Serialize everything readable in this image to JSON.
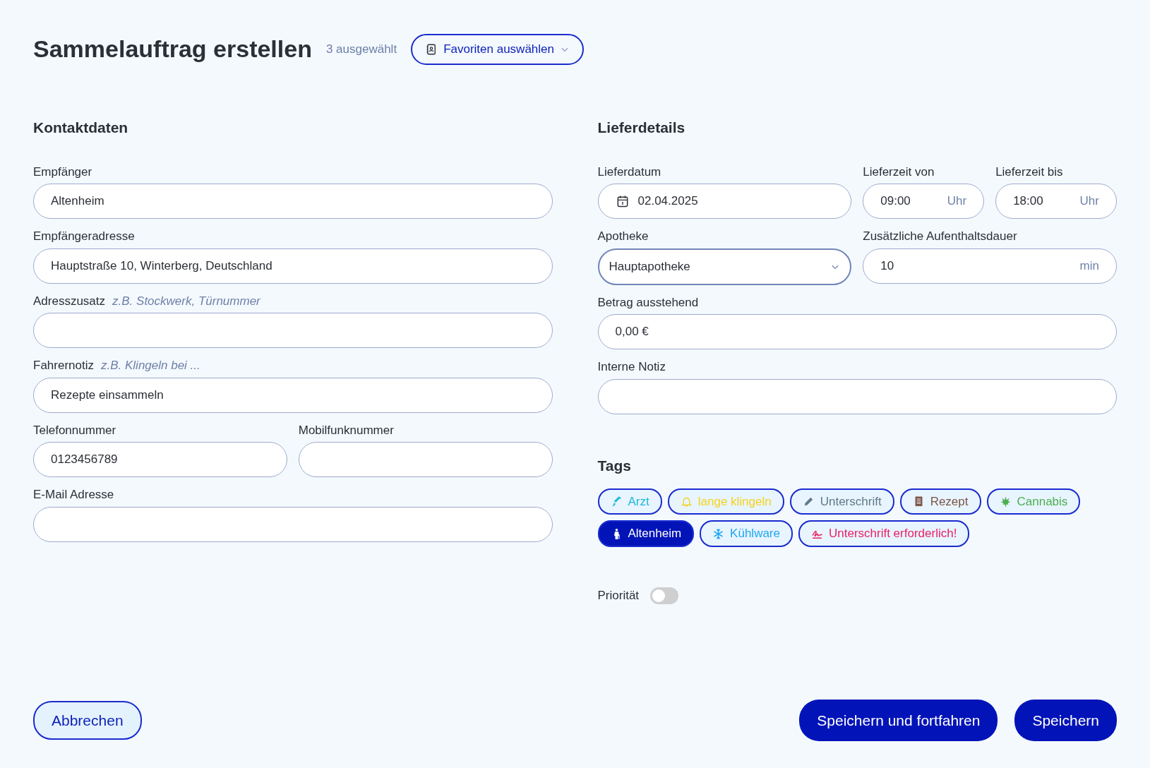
{
  "header": {
    "title": "Sammelauftrag erstellen",
    "selected_count": "3 ausgewählt",
    "favorites_button": "Favoriten auswählen"
  },
  "contact": {
    "title": "Kontaktdaten",
    "rows": [
      [
        {
          "kind": "text",
          "label": "Empfänger",
          "value": "Altenheim"
        }
      ],
      [
        {
          "kind": "text",
          "label": "Empfängeradresse",
          "value": "Hauptstraße 10, Winterberg, Deutschland"
        }
      ],
      [
        {
          "kind": "text",
          "label": "Adresszusatz",
          "hint": "z.B. Stockwerk, Türnummer"
        }
      ],
      [
        {
          "kind": "text",
          "label": "Fahrernotiz",
          "hint": "z.B. Klingeln bei ...",
          "value": "Rezepte einsammeln"
        }
      ],
      [
        {
          "kind": "text",
          "label": "Telefonnummer",
          "value": "0123456789"
        },
        {
          "kind": "text",
          "label": "Mobilfunknummer"
        }
      ],
      [
        {
          "kind": "text",
          "label": "E-Mail Adresse"
        }
      ]
    ]
  },
  "delivery": {
    "title": "Lieferdetails",
    "rows": [
      [
        {
          "kind": "date",
          "label": "Lieferdatum",
          "value": "02.04.2025"
        },
        {
          "kind": "time",
          "label": "Lieferzeit von",
          "value": "09:00",
          "suffix": "Uhr"
        },
        {
          "kind": "time",
          "label": "Lieferzeit bis",
          "value": "18:00",
          "suffix": "Uhr"
        }
      ],
      [
        {
          "kind": "select",
          "label": "Apotheke",
          "value": "Hauptapotheke"
        },
        {
          "kind": "suffixed",
          "label": "Zusätzliche Aufenthaltsdauer",
          "value": "10",
          "suffix": "min"
        }
      ],
      [
        {
          "kind": "text",
          "label": "Betrag ausstehend",
          "value": "0,00 €"
        }
      ],
      [
        {
          "kind": "text",
          "label": "Interne Notiz"
        }
      ]
    ]
  },
  "tags": {
    "title": "Tags",
    "items": [
      {
        "kind": "syringe",
        "label": "Arzt",
        "color": "#1cb8d8",
        "selected": false
      },
      {
        "kind": "bell",
        "label": "lange klingeln",
        "color": "#f5d31c",
        "selected": false
      },
      {
        "kind": "pen",
        "label": "Unterschrift",
        "color": "#5f7a89",
        "selected": false
      },
      {
        "kind": "receipt",
        "label": "Rezept",
        "color": "#7a5548",
        "selected": false
      },
      {
        "kind": "leaf",
        "label": "Cannabis",
        "color": "#4caf50",
        "selected": false
      },
      {
        "kind": "person",
        "label": "Altenheim",
        "selected": true
      },
      {
        "kind": "snowflake",
        "label": "Kühlware",
        "color": "#1ea7f0",
        "selected": false
      },
      {
        "kind": "signature",
        "label": "Unterschrift erforderlich!",
        "color": "#ea1f63",
        "selected": false
      }
    ]
  },
  "priority": {
    "label": "Priorität",
    "on": false
  },
  "footer": {
    "cancel": "Abbrechen",
    "save_continue": "Speichern und fortfahren",
    "save": "Speichern"
  }
}
